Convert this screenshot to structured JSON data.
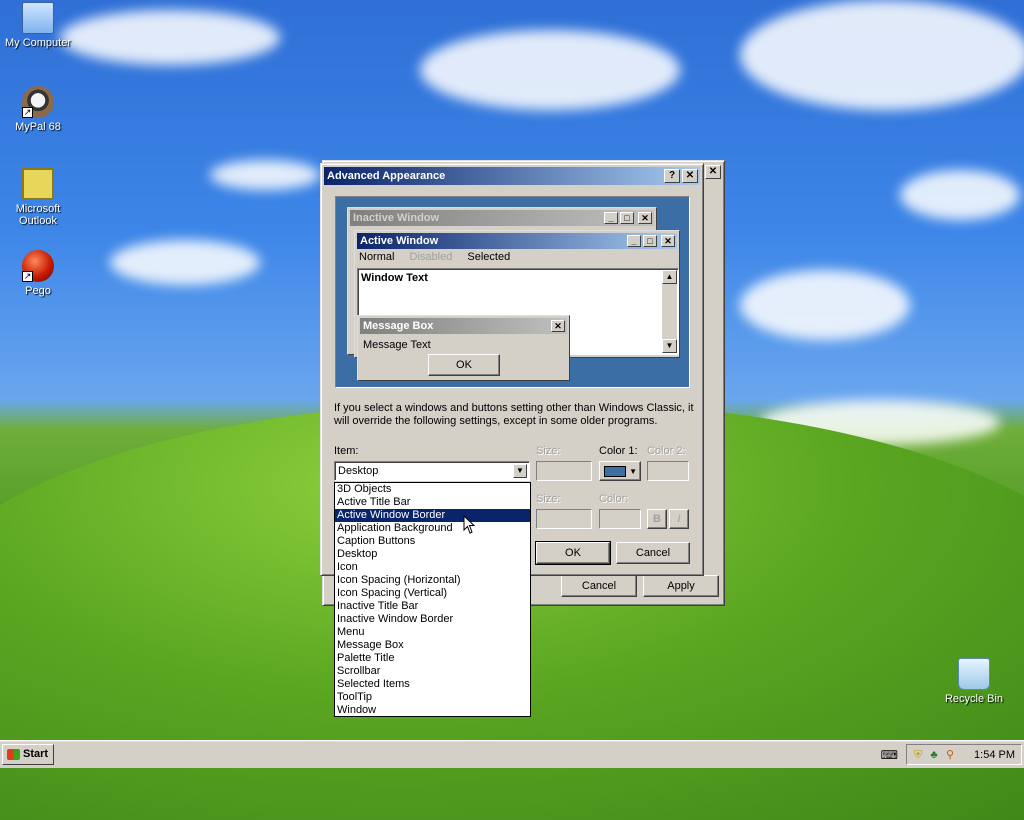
{
  "desktop": {
    "icons": [
      {
        "label": "My Computer"
      },
      {
        "label": "MyPal 68"
      },
      {
        "label": "Microsoft Outlook"
      },
      {
        "label": "Pego"
      },
      {
        "label": "Recycle Bin"
      }
    ]
  },
  "back_window": {
    "cancel_label": "Cancel",
    "apply_label": "Apply",
    "close_glyph": "✕"
  },
  "dialog": {
    "title": "Advanced Appearance",
    "help_glyph": "?",
    "close_glyph": "✕",
    "preview": {
      "inactive_title": "Inactive Window",
      "active_title": "Active Window",
      "menu_normal": "Normal",
      "menu_disabled": "Disabled",
      "menu_selected": "Selected",
      "window_text": "Window Text",
      "msgbox_title": "Message Box",
      "msgbox_text": "Message Text",
      "msgbox_ok": "OK"
    },
    "info_text": "If you select a windows and buttons setting other than Windows Classic, it will override the following settings, except in some older programs.",
    "item_label": "Item:",
    "item_value": "Desktop",
    "size_label": "Size:",
    "color1_label": "Color 1:",
    "color2_label": "Color 2:",
    "font_size_label": "Size:",
    "font_color_label": "Color:",
    "bold_glyph": "B",
    "italic_glyph": "I",
    "ok_label": "OK",
    "cancel_label": "Cancel",
    "color1_value": "#3a6ea5"
  },
  "item_dropdown": {
    "options": [
      "3D Objects",
      "Active Title Bar",
      "Active Window Border",
      "Application Background",
      "Caption Buttons",
      "Desktop",
      "Icon",
      "Icon Spacing (Horizontal)",
      "Icon Spacing (Vertical)",
      "Inactive Title Bar",
      "Inactive Window Border",
      "Menu",
      "Message Box",
      "Palette Title",
      "Scrollbar",
      "Selected Items",
      "ToolTip",
      "Window"
    ],
    "highlighted": "Active Window Border"
  },
  "taskbar": {
    "start_label": "Start",
    "clock": "1:54 PM"
  },
  "colors": {
    "active_title_start": "#0a246a",
    "active_title_end": "#a6caf0",
    "inactive_title_start": "#808080",
    "inactive_title_end": "#c0c0c0",
    "desktop_preview": "#3a6ea5",
    "face": "#d4d0c8"
  }
}
